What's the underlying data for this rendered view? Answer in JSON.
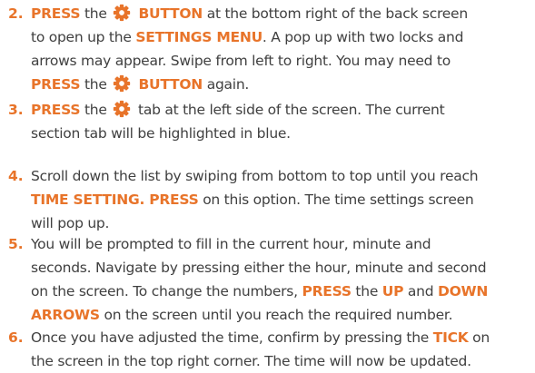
{
  "colors": {
    "text": "#404040",
    "accent": "#e8742a"
  },
  "icons": {
    "settings": "gear-icon"
  },
  "steps": [
    {
      "number": "2.",
      "lines": [
        [
          {
            "t": "s",
            "v": "PRESS"
          },
          {
            "t": "n",
            "v": " the "
          },
          {
            "t": "i"
          },
          {
            "t": "s",
            "v": " BUTTON"
          },
          {
            "t": "n",
            "v": " at the bottom right of the back screen"
          }
        ],
        [
          {
            "t": "n",
            "v": "to open up the "
          },
          {
            "t": "s",
            "v": "SETTINGS MENU"
          },
          {
            "t": "n",
            "v": ". A pop up with two locks and"
          }
        ],
        [
          {
            "t": "n",
            "v": "arrows may appear. Swipe from left to right. You may need to"
          }
        ],
        [
          {
            "t": "s",
            "v": "PRESS"
          },
          {
            "t": "n",
            "v": " the "
          },
          {
            "t": "i"
          },
          {
            "t": "s",
            "v": " BUTTON"
          },
          {
            "t": "n",
            "v": " again."
          }
        ]
      ]
    },
    {
      "number": "3.",
      "lines": [
        [
          {
            "t": "s",
            "v": "PRESS"
          },
          {
            "t": "n",
            "v": " the "
          },
          {
            "t": "i"
          },
          {
            "t": "n",
            "v": " tab at the left side of the screen. The current"
          }
        ],
        [
          {
            "t": "n",
            "v": "section tab will be highlighted in blue."
          }
        ]
      ]
    },
    {
      "number": "4.",
      "lines": [
        [
          {
            "t": "n",
            "v": "Scroll down the list by swiping from bottom to top until you reach"
          }
        ],
        [
          {
            "t": "s",
            "v": "TIME SETTING. PRESS"
          },
          {
            "t": "n",
            "v": " on this option. The time settings screen"
          }
        ],
        [
          {
            "t": "n",
            "v": "will pop up."
          }
        ]
      ]
    },
    {
      "number": "5.",
      "lines": [
        [
          {
            "t": "n",
            "v": "You will be prompted to fill in the current hour, minute and"
          }
        ],
        [
          {
            "t": "n",
            "v": "seconds. Navigate by pressing either the hour, minute and second"
          }
        ],
        [
          {
            "t": "n",
            "v": "on the screen. To change the numbers, "
          },
          {
            "t": "s",
            "v": "PRESS"
          },
          {
            "t": "n",
            "v": " the "
          },
          {
            "t": "s",
            "v": "UP"
          },
          {
            "t": "n",
            "v": " and "
          },
          {
            "t": "s",
            "v": "DOWN"
          }
        ],
        [
          {
            "t": "s",
            "v": "ARROWS"
          },
          {
            "t": "n",
            "v": " on the screen until you reach the required number."
          }
        ]
      ]
    },
    {
      "number": "6.",
      "lines": [
        [
          {
            "t": "n",
            "v": "Once you have adjusted the time, confirm by pressing the "
          },
          {
            "t": "s",
            "v": "TICK"
          },
          {
            "t": "n",
            "v": " on"
          }
        ],
        [
          {
            "t": "n",
            "v": "the screen in the top right corner. The time will now be updated."
          }
        ]
      ]
    }
  ]
}
